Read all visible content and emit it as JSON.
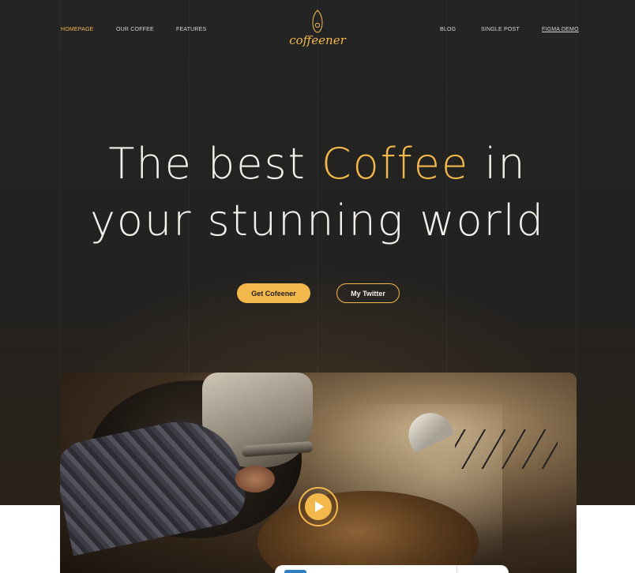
{
  "nav": {
    "left": [
      {
        "label": "HOMEPAGE",
        "active": true
      },
      {
        "label": "OUR COFFEE"
      },
      {
        "label": "FEATURES"
      }
    ],
    "right": [
      {
        "label": "BLOG"
      },
      {
        "label": "SINGLE POST"
      },
      {
        "label": "FIGMA DEMO",
        "underlined": true
      }
    ]
  },
  "logo": {
    "text": "coffeener",
    "icon": "coffee-bean-logo-icon"
  },
  "hero": {
    "line1_before": "The best ",
    "line1_accent": "Coffee",
    "line1_after": " in",
    "line2": "your stunning world",
    "primary_button": "Get Cofeener",
    "secondary_button": "My Twitter"
  },
  "media": {
    "play_icon": "play-icon"
  },
  "colors": {
    "accent": "#f2b84b",
    "background": "#242424",
    "text": "#f4f1ea"
  }
}
